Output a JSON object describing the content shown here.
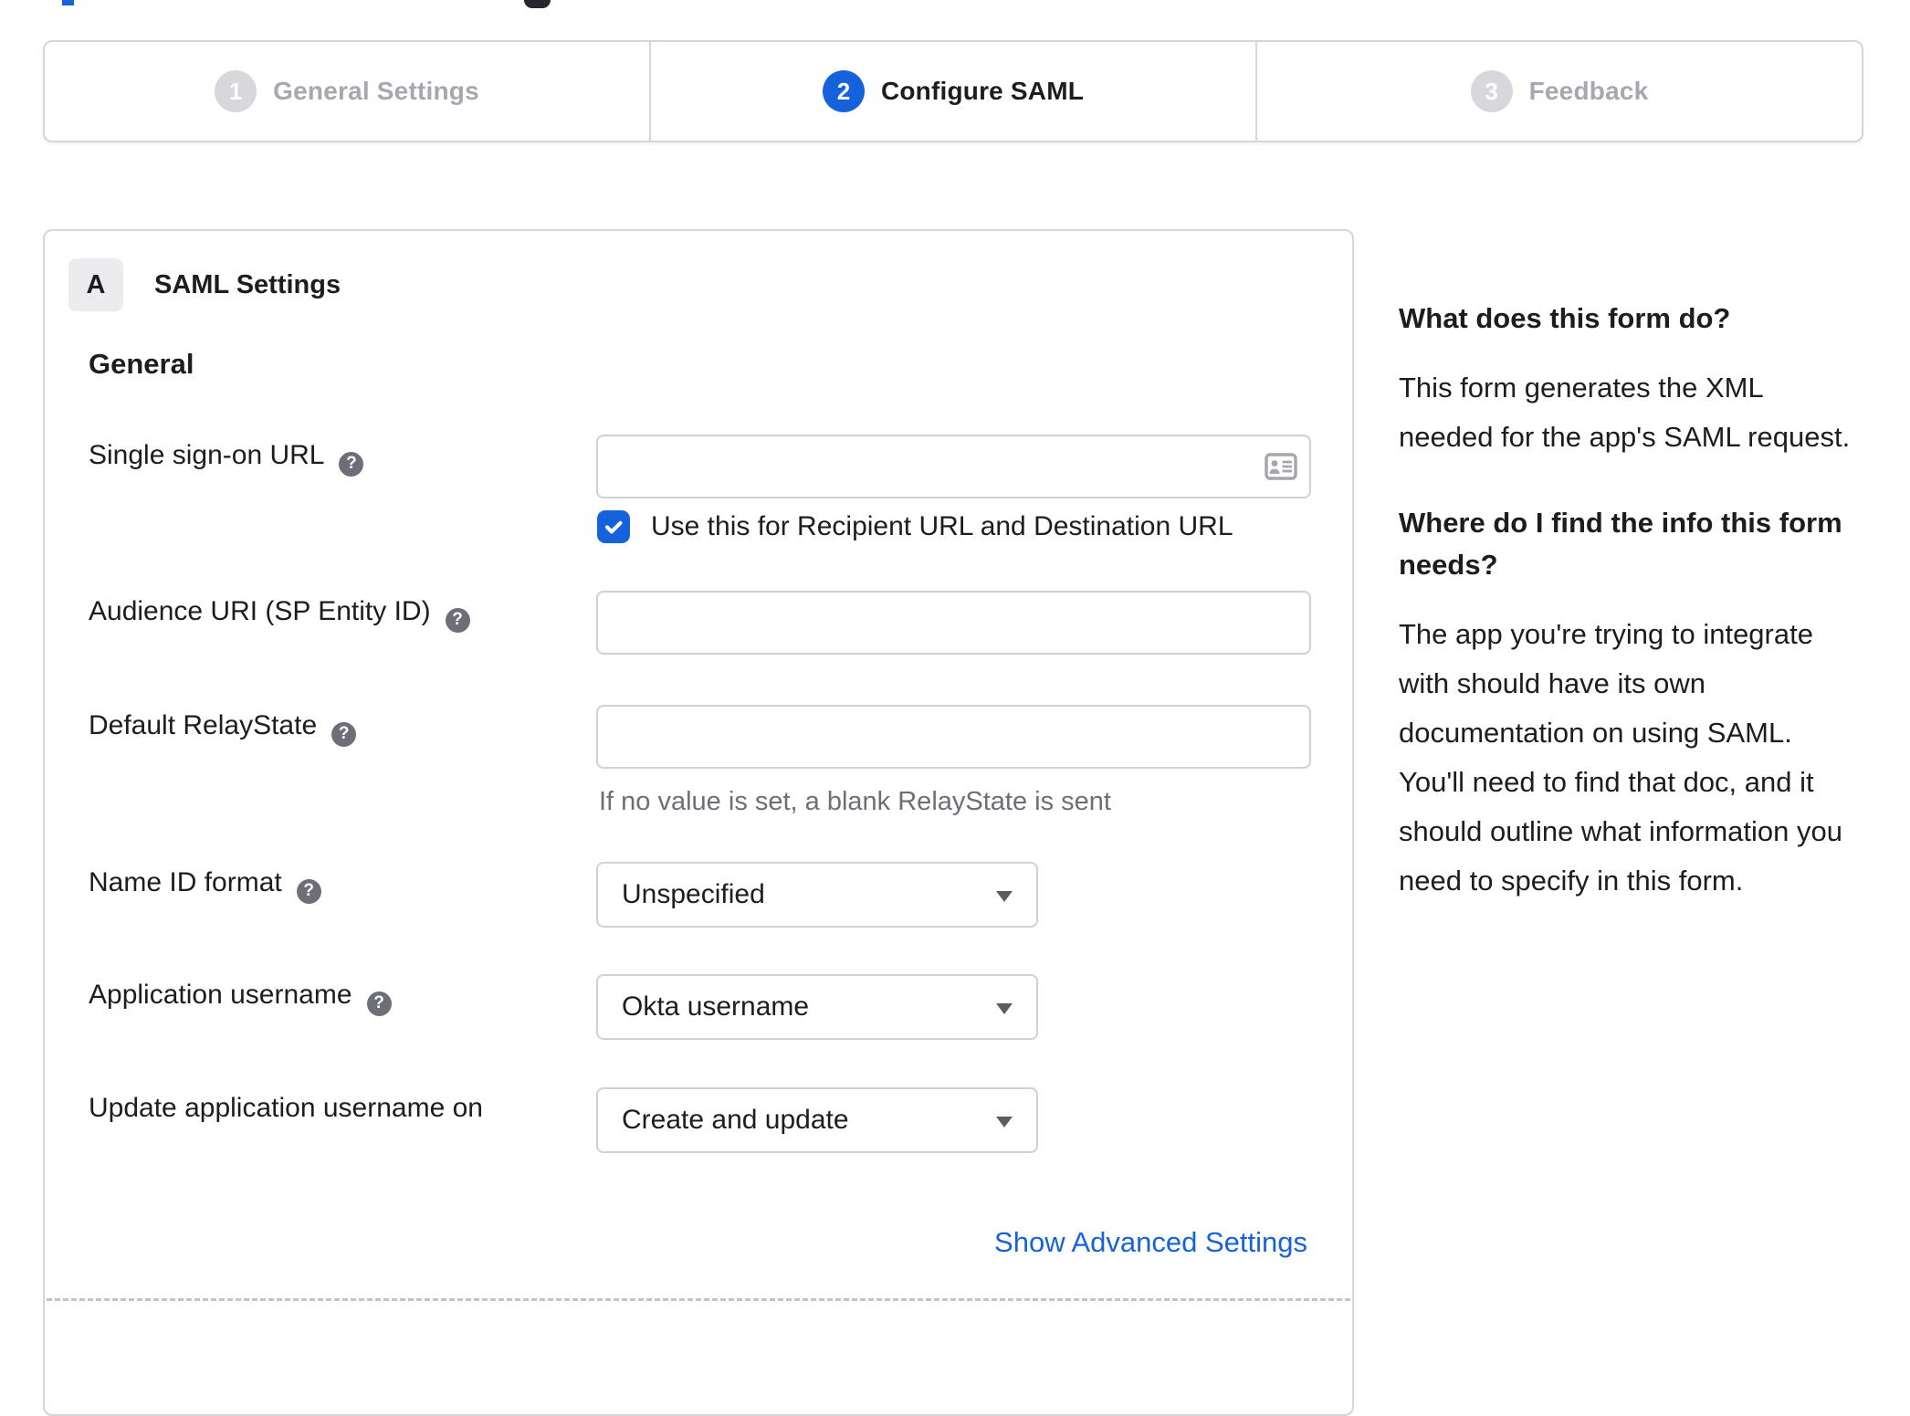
{
  "stepper": {
    "steps": [
      {
        "number": "1",
        "label": "General Settings",
        "state": "inactive"
      },
      {
        "number": "2",
        "label": "Configure SAML",
        "state": "active"
      },
      {
        "number": "3",
        "label": "Feedback",
        "state": "inactive"
      }
    ]
  },
  "panel": {
    "section_badge": "A",
    "section_title": "SAML Settings",
    "group_title": "General",
    "fields": {
      "sso": {
        "label": "Single sign-on URL",
        "value": ""
      },
      "sso_checkbox": {
        "label": "Use this for Recipient URL and Destination URL",
        "checked": true
      },
      "audience": {
        "label": "Audience URI (SP Entity ID)",
        "value": ""
      },
      "relay": {
        "label": "Default RelayState",
        "value": "",
        "hint": "If no value is set, a blank RelayState is sent"
      },
      "name_id": {
        "label": "Name ID format",
        "value": "Unspecified"
      },
      "app_username": {
        "label": "Application username",
        "value": "Okta username"
      },
      "update_username": {
        "label": "Update application username on",
        "value": "Create and update"
      }
    },
    "advanced_link": "Show Advanced Settings"
  },
  "help_panel": {
    "heading1": "What does this form do?",
    "body1": "This form generates the XML needed for the app's SAML request.",
    "heading2": "Where do I find the info this form needs?",
    "body2": "The app you're trying to integrate with should have its own documentation on using SAML. You'll need to find that doc, and it should outline what information you need to specify in this form."
  },
  "icons": {
    "sso_input_icon": "contact-card-icon",
    "help_icon": "question-mark-icon",
    "select_icon": "chevron-down-icon",
    "checkbox_icon": "checkmark-icon"
  },
  "colors": {
    "accent_blue": "#1662dd",
    "step_inactive_gray": "#d7d7dc",
    "text": "#1d1d21",
    "muted_text": "#6e6e78",
    "border": "#d5d5da"
  }
}
